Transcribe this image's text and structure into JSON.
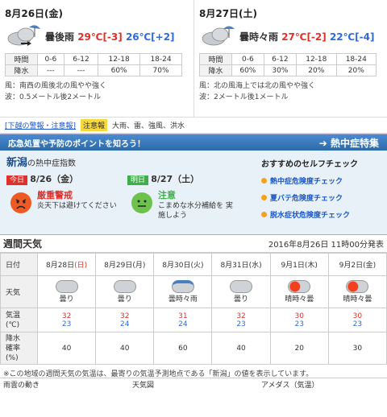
{
  "today": {
    "title": "8月26日(金)",
    "condition": "曇後雨",
    "hi": "29℃",
    "hi_diff": "[-3]",
    "lo": "26℃",
    "lo_diff": "[+2]",
    "periods": [
      "0-6",
      "6-12",
      "12-18",
      "18-24"
    ],
    "time_label": "時間",
    "rain_label": "降水",
    "rain": [
      "---",
      "---",
      "60%",
      "70%"
    ],
    "wind": "風：南西の風後北の風やや強く",
    "wave": "波：0.5メートル後2メートル"
  },
  "tomorrow": {
    "title": "8月27日(土)",
    "condition": "曇時々雨",
    "hi": "27℃",
    "hi_diff": "[-2]",
    "lo": "22℃",
    "lo_diff": "[-4]",
    "periods": [
      "0-6",
      "6-12",
      "12-18",
      "18-24"
    ],
    "time_label": "時間",
    "rain_label": "降水",
    "rain": [
      "60%",
      "30%",
      "20%",
      "20%"
    ],
    "wind": "風：北の風海上では北の風やや強く",
    "wave": "波：2メートル後1メートル"
  },
  "warnings": {
    "link": "[下越の警報・注意報]",
    "badge": "注意報",
    "items": "大雨、雷、強風、洪水"
  },
  "heat": {
    "banner": "応急処置や予防のポイントを知ろう！",
    "feature": "熱中症特集",
    "location": "新潟",
    "index_label": "の熱中症指数",
    "today_tag": "今日",
    "today_date": "8/26（金）",
    "today_level": "厳重警戒",
    "today_msg": "炎天下は避けてください",
    "tomorrow_tag": "明日",
    "tomorrow_date": "8/27（土）",
    "tomorrow_level": "注意",
    "tomorrow_msg": "こまめな水分補給を 実施しよう",
    "check_title": "おすすめのセルフチェック",
    "checks": [
      "熱中症危険度チェック",
      "夏バテ危険度チェック",
      "脱水症状危険度チェック"
    ]
  },
  "weekly": {
    "title": "週間天気",
    "updated": "2016年8月26日 11時00分発表",
    "row_labels": [
      "日付",
      "天気",
      "気温\n(℃)",
      "降水\n確率\n(%)"
    ],
    "days": [
      {
        "date": "8月28日",
        "dow": "(日)",
        "weather": "曇り",
        "hi": "32",
        "lo": "23",
        "pop": "40"
      },
      {
        "date": "8月29日",
        "dow": "(月)",
        "weather": "曇り",
        "hi": "32",
        "lo": "24",
        "pop": "40"
      },
      {
        "date": "8月30日",
        "dow": "(火)",
        "weather": "曇時々雨",
        "hi": "31",
        "lo": "24",
        "pop": "60"
      },
      {
        "date": "8月31日",
        "dow": "(水)",
        "weather": "曇り",
        "hi": "32",
        "lo": "23",
        "pop": "40"
      },
      {
        "date": "9月1日",
        "dow": "(木)",
        "weather": "晴時々曇",
        "hi": "30",
        "lo": "23",
        "pop": "20"
      },
      {
        "date": "9月2日",
        "dow": "(金)",
        "weather": "晴時々曇",
        "hi": "30",
        "lo": "23",
        "pop": "30"
      }
    ],
    "note": "※この地域の週間天気の気温は、最寄りの気温予測地点である「新潟」の値を表示しています。"
  },
  "footer": {
    "col1": "雨雲の動き",
    "col2": "天気図",
    "col3": "アメダス（気温）"
  }
}
